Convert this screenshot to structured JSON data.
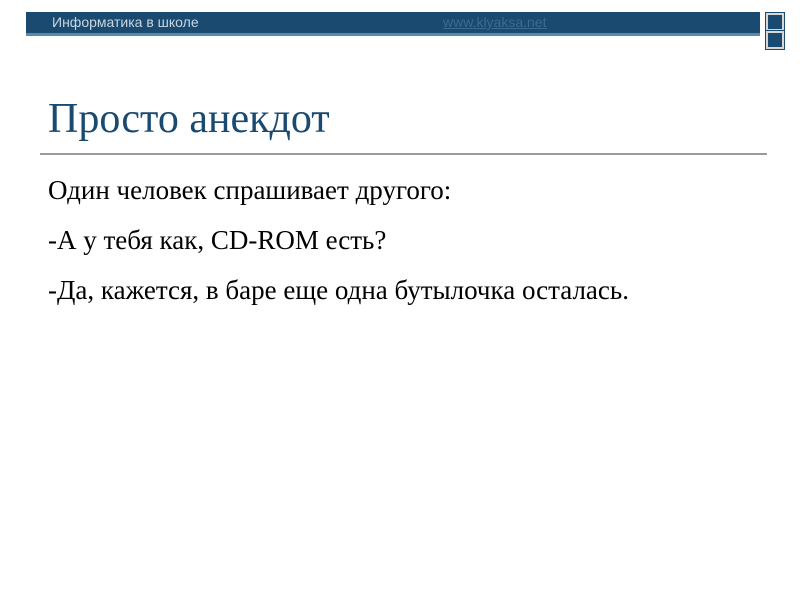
{
  "header": {
    "course": "Информатика в школе",
    "site": "www.klyaksa.net"
  },
  "slide": {
    "title": "Просто анекдот",
    "lines": [
      "Один человек спрашивает другого:",
      "-А у тебя как, CD-ROM есть?",
      "-Да, кажется, в баре еще одна бутылочка осталась."
    ]
  },
  "colors": {
    "header_bar": "#1a4a70",
    "title": "#1a4a70",
    "body_text": "#000000"
  }
}
